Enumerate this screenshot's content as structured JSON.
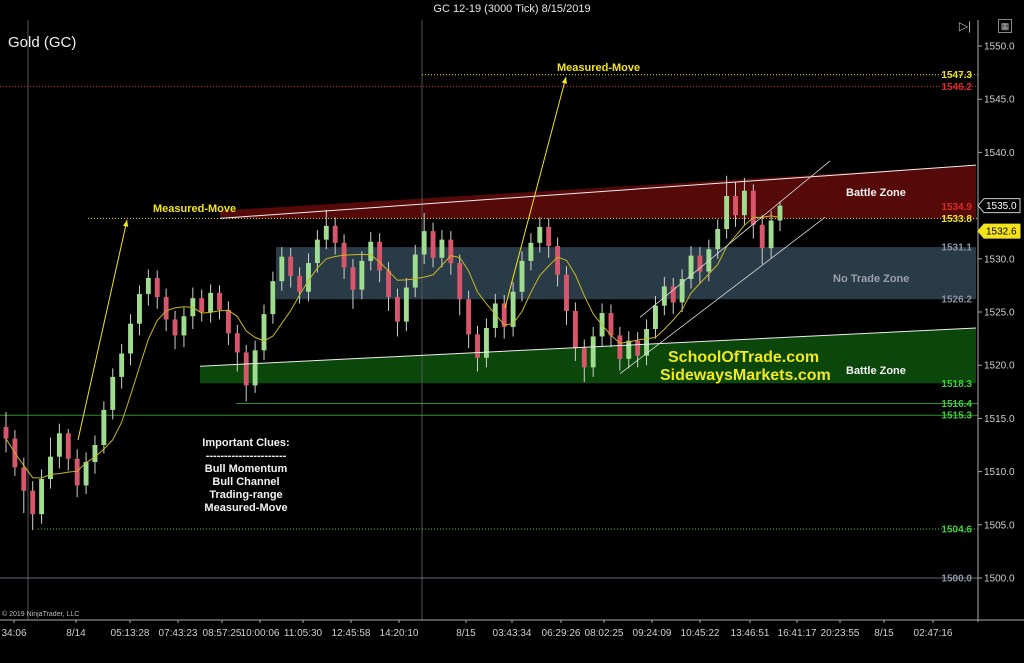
{
  "header": {
    "title": "GC 12-19 (3000 Tick)  8/15/2019",
    "symbol": "Gold (GC)",
    "copyright": "© 2019 NinjaTrader, LLC"
  },
  "chart_data": {
    "type": "candlestick",
    "title": "GC 12-19 (3000 Tick)  8/15/2019",
    "ylim": [
      1497.0,
      1553.0
    ],
    "y_ticks": [
      1500.0,
      1505.0,
      1510.0,
      1515.0,
      1520.0,
      1525.0,
      1530.0,
      1535.0,
      1540.0,
      1545.0,
      1550.0
    ],
    "x_labels": [
      "34:06",
      "8/14",
      "05:13:28",
      "07:43:23",
      "08:57:25",
      "10:00:06",
      "11:05:30",
      "12:45:58",
      "14:20:10",
      "8/15",
      "03:43:34",
      "06:29:26",
      "08:02:25",
      "09:24:09",
      "10:45:22",
      "13:46:51",
      "16:41:17",
      "20:23:55",
      "8/15",
      "02:47:16"
    ],
    "price_levels": [
      {
        "value": 1547.3,
        "label": "1547.3",
        "color": "#f2e31b",
        "style": "dotted"
      },
      {
        "value": 1546.2,
        "label": "1546.2",
        "color": "#e02828",
        "style": "dotted"
      },
      {
        "value": 1534.9,
        "label": "1534.9",
        "color": "#e02828",
        "style": "none"
      },
      {
        "value": 1533.8,
        "label": "1533.8",
        "color": "#f2e31b",
        "style": "dotted"
      },
      {
        "value": 1531.1,
        "label": "1531.1",
        "color": "#8c96a6",
        "style": "none"
      },
      {
        "value": 1526.2,
        "label": "1526.2",
        "color": "#8c96a6",
        "style": "none"
      },
      {
        "value": 1518.3,
        "label": "1518.3",
        "color": "#3fd13f",
        "style": "none"
      },
      {
        "value": 1516.4,
        "label": "1516.4",
        "color": "#3fd13f",
        "style": "solid"
      },
      {
        "value": 1515.3,
        "label": "1515.3",
        "color": "#3fd13f",
        "style": "solid"
      },
      {
        "value": 1504.6,
        "label": "1504.6",
        "color": "#3fd13f",
        "style": "dotted"
      },
      {
        "value": 1500.0,
        "label": "1500.0",
        "color": "#8c96a6",
        "style": "solid"
      }
    ],
    "current_prices": [
      {
        "value": 1535.0,
        "label": "1535.0",
        "style": "white"
      },
      {
        "value": 1532.6,
        "label": "1532.6",
        "style": "yellow"
      }
    ],
    "zones": [
      {
        "name": "Battle Zone",
        "type": "resistance",
        "from": 1533.8,
        "to_start": 1534.9,
        "to_end": 1538.8,
        "color": "#5a0a0a"
      },
      {
        "name": "No Trade Zone",
        "type": "range",
        "from": 1526.2,
        "to": 1531.1,
        "color": "#2c3e4c"
      },
      {
        "name": "Battle Zone",
        "type": "support",
        "from": 1518.3,
        "to_start": 1519.9,
        "to_end": 1523.5,
        "color": "#0c4a0c"
      }
    ],
    "candles": [
      [
        1514.2,
        1513.1,
        1515.6,
        1511.8
      ],
      [
        1513.1,
        1510.4,
        1513.9,
        1509.6
      ],
      [
        1510.4,
        1508.2,
        1511.3,
        1506.1
      ],
      [
        1508.2,
        1506.0,
        1509.1,
        1504.5
      ],
      [
        1506.0,
        1509.3,
        1510.2,
        1505.1
      ],
      [
        1509.3,
        1511.4,
        1513.2,
        1508.4
      ],
      [
        1511.4,
        1513.6,
        1514.5,
        1510.3
      ],
      [
        1513.6,
        1511.2,
        1514.0,
        1510.1
      ],
      [
        1511.2,
        1508.7,
        1512.1,
        1507.6
      ],
      [
        1508.7,
        1510.9,
        1511.8,
        1507.9
      ],
      [
        1510.9,
        1512.5,
        1513.4,
        1509.8
      ],
      [
        1512.5,
        1515.8,
        1516.6,
        1511.7
      ],
      [
        1515.8,
        1518.9,
        1519.7,
        1514.9
      ],
      [
        1518.9,
        1521.1,
        1522.0,
        1517.8
      ],
      [
        1521.1,
        1523.9,
        1524.8,
        1520.0
      ],
      [
        1523.9,
        1526.7,
        1527.5,
        1522.8
      ],
      [
        1526.7,
        1528.2,
        1529.0,
        1525.6
      ],
      [
        1528.2,
        1526.4,
        1528.9,
        1525.3
      ],
      [
        1526.4,
        1524.3,
        1527.2,
        1523.2
      ],
      [
        1524.3,
        1522.8,
        1525.1,
        1521.5
      ],
      [
        1522.8,
        1524.6,
        1525.4,
        1521.7
      ],
      [
        1524.6,
        1526.3,
        1527.3,
        1523.4
      ],
      [
        1526.3,
        1525.0,
        1527.1,
        1524.1
      ],
      [
        1525.0,
        1526.8,
        1527.6,
        1524.0
      ],
      [
        1526.8,
        1525.2,
        1527.5,
        1524.3
      ],
      [
        1525.2,
        1523.0,
        1526.0,
        1521.9
      ],
      [
        1523.0,
        1521.2,
        1523.8,
        1519.4
      ],
      [
        1521.2,
        1518.1,
        1521.9,
        1516.6
      ],
      [
        1518.1,
        1521.4,
        1522.3,
        1517.4
      ],
      [
        1521.4,
        1524.8,
        1525.7,
        1520.5
      ],
      [
        1524.8,
        1527.9,
        1528.8,
        1523.9
      ],
      [
        1527.9,
        1530.2,
        1531.1,
        1527.0
      ],
      [
        1530.2,
        1528.4,
        1531.0,
        1527.3
      ],
      [
        1528.4,
        1526.9,
        1529.2,
        1525.8
      ],
      [
        1526.9,
        1529.6,
        1530.5,
        1526.0
      ],
      [
        1529.6,
        1531.8,
        1532.7,
        1528.7
      ],
      [
        1531.8,
        1533.1,
        1534.6,
        1530.9
      ],
      [
        1533.1,
        1531.5,
        1533.9,
        1530.4
      ],
      [
        1531.5,
        1529.2,
        1532.3,
        1528.1
      ],
      [
        1529.2,
        1527.1,
        1530.0,
        1525.3
      ],
      [
        1527.1,
        1529.8,
        1530.7,
        1526.2
      ],
      [
        1529.8,
        1531.6,
        1532.5,
        1528.9
      ],
      [
        1531.6,
        1528.9,
        1532.4,
        1527.8
      ],
      [
        1528.9,
        1526.4,
        1529.7,
        1525.1
      ],
      [
        1526.4,
        1524.1,
        1527.2,
        1522.7
      ],
      [
        1524.1,
        1527.3,
        1528.2,
        1523.2
      ],
      [
        1527.3,
        1530.4,
        1531.3,
        1526.4
      ],
      [
        1530.4,
        1532.6,
        1534.3,
        1529.5
      ],
      [
        1532.6,
        1530.1,
        1533.4,
        1529.2
      ],
      [
        1530.1,
        1531.8,
        1532.7,
        1529.2
      ],
      [
        1531.8,
        1529.6,
        1532.6,
        1528.5
      ],
      [
        1529.6,
        1526.2,
        1530.4,
        1524.7
      ],
      [
        1526.2,
        1522.9,
        1527.0,
        1521.6
      ],
      [
        1522.9,
        1520.7,
        1523.7,
        1519.4
      ],
      [
        1520.7,
        1523.5,
        1524.4,
        1519.8
      ],
      [
        1523.5,
        1525.8,
        1526.7,
        1522.6
      ],
      [
        1525.8,
        1523.6,
        1526.6,
        1522.5
      ],
      [
        1523.6,
        1526.9,
        1527.8,
        1522.7
      ],
      [
        1526.9,
        1529.8,
        1530.7,
        1526.0
      ],
      [
        1529.8,
        1531.5,
        1532.4,
        1528.9
      ],
      [
        1531.5,
        1533.0,
        1533.9,
        1530.6
      ],
      [
        1533.0,
        1531.2,
        1533.8,
        1530.1
      ],
      [
        1531.2,
        1528.5,
        1532.0,
        1527.4
      ],
      [
        1528.5,
        1525.1,
        1529.3,
        1523.8
      ],
      [
        1525.1,
        1521.6,
        1525.9,
        1520.4
      ],
      [
        1521.6,
        1519.8,
        1522.4,
        1518.4
      ],
      [
        1519.8,
        1522.7,
        1523.6,
        1518.9
      ],
      [
        1522.7,
        1524.9,
        1525.8,
        1521.8
      ],
      [
        1524.9,
        1522.8,
        1525.7,
        1521.7
      ],
      [
        1522.8,
        1520.6,
        1523.6,
        1519.5
      ],
      [
        1520.6,
        1522.3,
        1523.2,
        1519.7
      ],
      [
        1522.3,
        1520.9,
        1523.1,
        1519.8
      ],
      [
        1520.9,
        1523.4,
        1524.3,
        1520.0
      ],
      [
        1523.4,
        1525.6,
        1526.5,
        1522.5
      ],
      [
        1525.6,
        1527.4,
        1528.3,
        1524.7
      ],
      [
        1527.4,
        1525.9,
        1528.2,
        1524.8
      ],
      [
        1525.9,
        1528.1,
        1529.0,
        1525.0
      ],
      [
        1528.1,
        1530.3,
        1531.2,
        1527.2
      ],
      [
        1530.3,
        1528.8,
        1531.1,
        1527.7
      ],
      [
        1528.8,
        1530.9,
        1531.8,
        1527.9
      ],
      [
        1530.9,
        1532.8,
        1533.7,
        1530.0
      ],
      [
        1532.8,
        1535.9,
        1537.8,
        1531.9
      ],
      [
        1535.9,
        1534.1,
        1537.2,
        1533.0
      ],
      [
        1534.1,
        1536.4,
        1537.6,
        1533.2
      ],
      [
        1536.4,
        1533.2,
        1537.0,
        1531.9
      ],
      [
        1533.2,
        1531.0,
        1534.1,
        1529.5
      ],
      [
        1531.0,
        1533.6,
        1534.5,
        1530.1
      ],
      [
        1533.6,
        1535.0,
        1535.4,
        1532.6
      ]
    ],
    "annotations": [
      {
        "text": "Measured-Move",
        "near": "left"
      },
      {
        "text": "Measured-Move",
        "near": "top"
      },
      {
        "text": "Battle Zone",
        "near": "resistance"
      },
      {
        "text": "No Trade Zone",
        "near": "range"
      },
      {
        "text": "Battle Zone",
        "near": "support"
      }
    ],
    "brand": [
      "SchoolOfTrade.com",
      "SidewaysMarkets.com"
    ],
    "clues": {
      "heading": "Important Clues:",
      "separator": "----------------------",
      "items": [
        "Bull Momentum",
        "Bull Channel",
        "Trading-range",
        "Measured-Move"
      ]
    },
    "colors": {
      "up": "#9fdc8f",
      "down": "#d8566b",
      "wick": "#d0d0d0",
      "ma": "#c8b820",
      "background": "#000000"
    }
  }
}
